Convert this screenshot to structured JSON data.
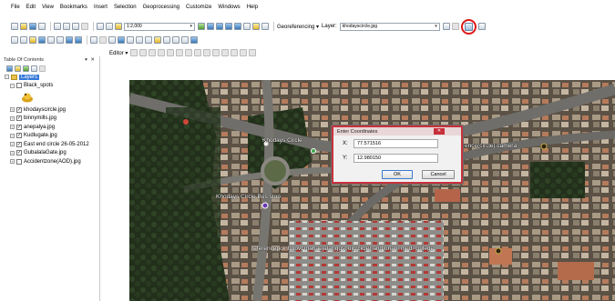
{
  "menu": [
    "File",
    "Edit",
    "View",
    "Bookmarks",
    "Insert",
    "Selection",
    "Geoprocessing",
    "Customize",
    "Windows",
    "Help"
  ],
  "toolbar": {
    "scale_value": "1:2,000",
    "georef_label": "Georeferencing ▾",
    "layer_label": "Layer:",
    "layer_value": "khodayscircle.jpg",
    "editor_label": "Editor ▾"
  },
  "toc": {
    "title": "Table Of Contents",
    "controls": "▾ ✕",
    "root_label": "Layers",
    "items": [
      {
        "label": "Black_spots",
        "checked": false
      },
      {
        "label": "khodayscircle.jpg",
        "checked": true
      },
      {
        "label": "binnymills.jpg",
        "checked": true
      },
      {
        "label": "anepalya.jpg",
        "checked": true
      },
      {
        "label": "Kudlugate.jpg",
        "checked": true
      },
      {
        "label": "East end circle 26-05-2012",
        "checked": true
      },
      {
        "label": "GubalalaGate.jpg",
        "checked": true
      },
      {
        "label": "Accidentzone(AOD).jpg",
        "checked": false
      }
    ]
  },
  "dialog": {
    "title": "Enter Coordinates",
    "close": "✕",
    "x_label": "X:",
    "x_value": "77.571516",
    "y_label": "Y:",
    "y_value": "12.980150",
    "ok": "OK",
    "cancel": "Cancel"
  },
  "map_labels": {
    "label1": "Khodays Circle",
    "label2": "ence(circle) camera",
    "label3": "Khodays Circle Bus stop",
    "label4": "referencepoint(govt mahaejalat)gust uic(cicle) and unani medi college"
  },
  "colors": {
    "highlight": "#e01818",
    "selection": "#3478d8"
  }
}
